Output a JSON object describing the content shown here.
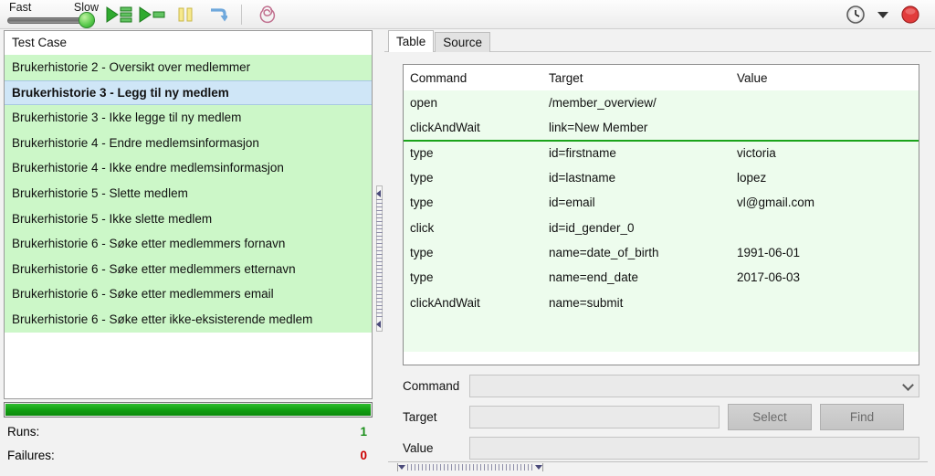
{
  "toolbar": {
    "speed_fast_label": "Fast",
    "speed_slow_label": "Slow",
    "speed_value": "Slow",
    "buttons": [
      {
        "name": "play-entire-suite",
        "icon": "play-all-icon"
      },
      {
        "name": "play-current-test-case",
        "icon": "play-current-icon"
      },
      {
        "name": "pause",
        "icon": "pause-icon"
      },
      {
        "name": "step",
        "icon": "step-icon"
      },
      {
        "name": "rollup",
        "icon": "spiral-rollup-icon"
      }
    ],
    "right_buttons": [
      {
        "name": "schedule",
        "icon": "clock-icon"
      },
      {
        "name": "schedule-dropdown",
        "icon": "chevron-down-icon"
      },
      {
        "name": "record",
        "icon": "record-circle-icon"
      }
    ]
  },
  "left_pane": {
    "header": "Test Case",
    "test_cases": [
      {
        "label": "Brukerhistorie 2 - Oversikt over medlemmer",
        "selected": false
      },
      {
        "label": "Brukerhistorie 3 - Legg til ny medlem",
        "selected": true
      },
      {
        "label": "Brukerhistorie 3 - Ikke legge til ny medlem",
        "selected": false
      },
      {
        "label": "Brukerhistorie 4 - Endre medlemsinformasjon",
        "selected": false
      },
      {
        "label": "Brukerhistorie 4 - Ikke endre medlemsinformasjon",
        "selected": false
      },
      {
        "label": "Brukerhistorie 5 - Slette medlem",
        "selected": false
      },
      {
        "label": "Brukerhistorie 5 - Ikke slette medlem",
        "selected": false
      },
      {
        "label": "Brukerhistorie 6 - Søke etter medlemmers fornavn",
        "selected": false
      },
      {
        "label": "Brukerhistorie 6 - Søke etter medlemmers etternavn",
        "selected": false
      },
      {
        "label": "Brukerhistorie 6 - Søke etter medlemmers email",
        "selected": false
      },
      {
        "label": "Brukerhistorie 6 - Søke etter ikke-eksisterende medlem",
        "selected": false
      }
    ],
    "progress_percent": 100,
    "progress_color": "#12a012",
    "stats": {
      "runs_label": "Runs:",
      "runs_value": "1",
      "runs_color": "#1a8f1a",
      "failures_label": "Failures:",
      "failures_value": "0",
      "failures_color": "#cc0000"
    }
  },
  "right_pane": {
    "tabs": [
      {
        "label": "Table",
        "active": true
      },
      {
        "label": "Source",
        "active": false
      }
    ],
    "table": {
      "columns": [
        "Command",
        "Target",
        "Value"
      ],
      "rows": [
        {
          "command": "open",
          "target": "/member_overview/",
          "value": "",
          "separator_after": false
        },
        {
          "command": "clickAndWait",
          "target": "link=New Member",
          "value": "",
          "separator_after": true
        },
        {
          "command": "type",
          "target": "id=firstname",
          "value": "victoria",
          "separator_after": false
        },
        {
          "command": "type",
          "target": "id=lastname",
          "value": "lopez",
          "separator_after": false
        },
        {
          "command": "type",
          "target": "id=email",
          "value": "vl@gmail.com",
          "separator_after": false
        },
        {
          "command": "click",
          "target": "id=id_gender_0",
          "value": "",
          "separator_after": false
        },
        {
          "command": "type",
          "target": "name=date_of_birth",
          "value": "1991-06-01",
          "separator_after": false
        },
        {
          "command": "type",
          "target": "name=end_date",
          "value": "2017-06-03",
          "separator_after": false
        },
        {
          "command": "clickAndWait",
          "target": "name=submit",
          "value": "",
          "separator_after": false
        }
      ]
    },
    "form": {
      "command_label": "Command",
      "command_value": "",
      "target_label": "Target",
      "target_value": "",
      "value_label": "Value",
      "value_value": "",
      "select_button": "Select",
      "find_button": "Find"
    }
  }
}
